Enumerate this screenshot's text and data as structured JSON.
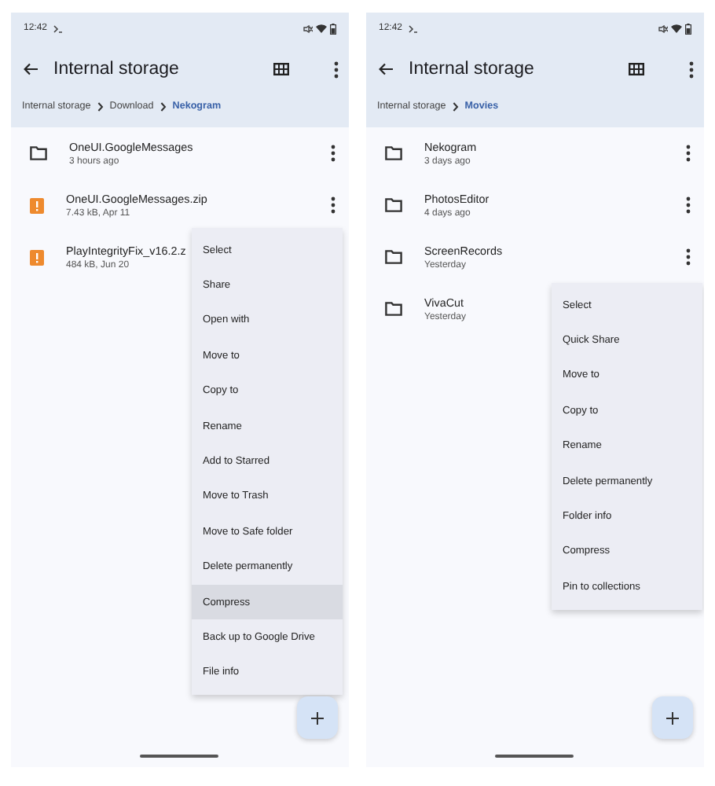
{
  "screens": [
    {
      "status_bar": {
        "time": "12:42"
      },
      "title": "Internal storage",
      "breadcrumbs": [
        {
          "label": "Internal storage",
          "selected": false
        },
        {
          "label": "Download",
          "selected": false
        },
        {
          "label": "Nekogram",
          "selected": true
        }
      ],
      "items": [
        {
          "kind": "folder",
          "name": "OneUI.GoogleMessages",
          "meta": "3 hours ago",
          "menu_button": true
        },
        {
          "kind": "file",
          "name": "OneUI.GoogleMessages.zip",
          "meta": "7.43 kB, Apr 11",
          "menu_button": true
        },
        {
          "kind": "file",
          "name": "PlayIntegrityFix_v16.2.z",
          "meta": "484 kB, Jun 20",
          "menu_button": false
        }
      ],
      "menu": {
        "items": [
          {
            "label": "Select",
            "selected": false
          },
          {
            "label": "Share",
            "selected": false
          },
          {
            "label": "Open with",
            "selected": false
          },
          {
            "label": "Move to",
            "selected": false
          },
          {
            "label": "Copy to",
            "selected": false
          },
          {
            "label": "Rename",
            "selected": false
          },
          {
            "label": "Add to Starred",
            "selected": false
          },
          {
            "label": "Move to Trash",
            "selected": false
          },
          {
            "label": "Move to Safe folder",
            "selected": false
          },
          {
            "label": "Delete permanently",
            "selected": false
          },
          {
            "label": "Compress",
            "selected": true
          },
          {
            "label": "Back up to Google Drive",
            "selected": false
          },
          {
            "label": "File info",
            "selected": false
          }
        ]
      }
    },
    {
      "status_bar": {
        "time": "12:42"
      },
      "title": "Internal storage",
      "breadcrumbs": [
        {
          "label": "Internal storage",
          "selected": false
        },
        {
          "label": "Movies",
          "selected": true
        }
      ],
      "items": [
        {
          "kind": "folder",
          "name": "Nekogram",
          "meta": "3 days ago",
          "menu_button": true
        },
        {
          "kind": "folder",
          "name": "PhotosEditor",
          "meta": "4 days ago",
          "menu_button": true
        },
        {
          "kind": "folder",
          "name": "ScreenRecords",
          "meta": "Yesterday",
          "menu_button": true
        },
        {
          "kind": "folder",
          "name": "VivaCut",
          "meta": "Yesterday",
          "menu_button": false
        }
      ],
      "menu": {
        "items": [
          {
            "label": "Select",
            "selected": false
          },
          {
            "label": "Quick Share",
            "selected": false
          },
          {
            "label": "Move to",
            "selected": false
          },
          {
            "label": "Copy to",
            "selected": false
          },
          {
            "label": "Rename",
            "selected": false
          },
          {
            "label": "Delete permanently",
            "selected": false
          },
          {
            "label": "Folder info",
            "selected": false
          },
          {
            "label": "Compress",
            "selected": false
          },
          {
            "label": "Pin to collections",
            "selected": false
          }
        ]
      }
    }
  ]
}
